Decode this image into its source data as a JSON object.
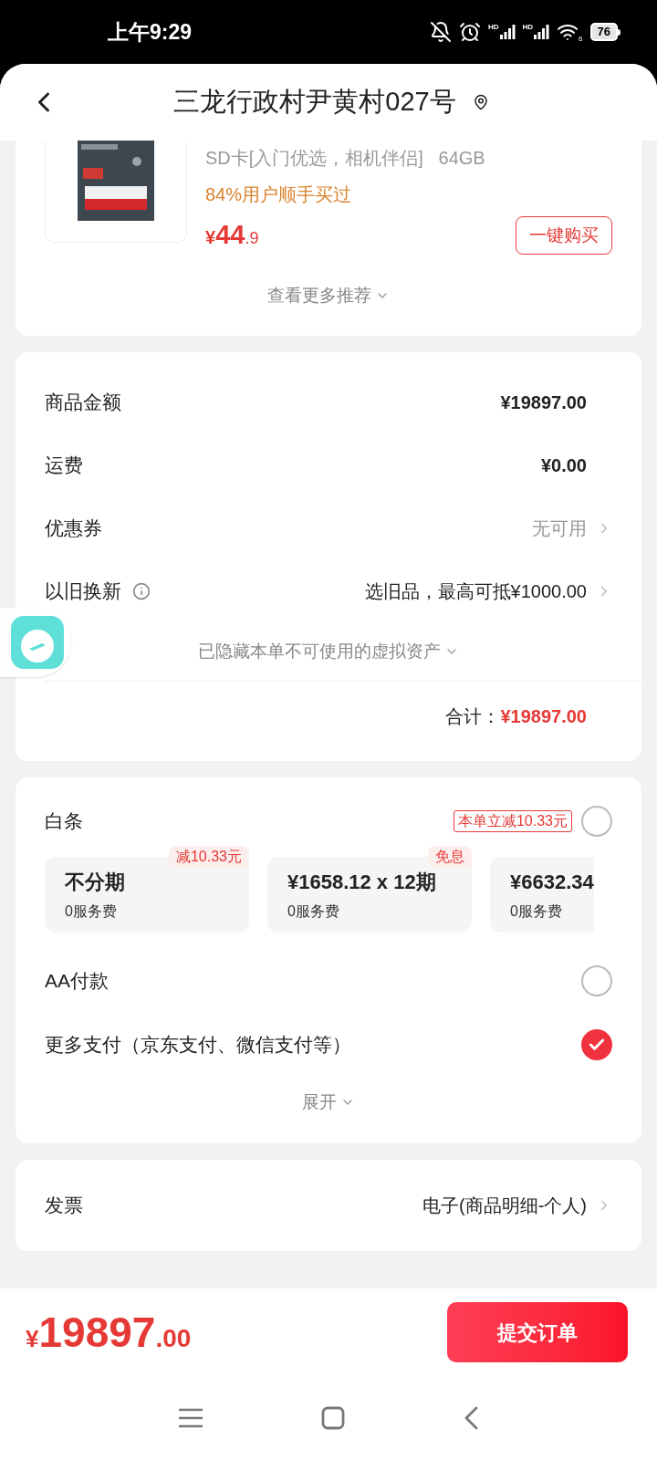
{
  "status_bar": {
    "time": "上午9:29",
    "network_labels": [
      "HD",
      "HD"
    ],
    "wifi_label": "6",
    "battery": "76"
  },
  "header": {
    "title": "三龙行政村尹黄村027号"
  },
  "recommendation": {
    "product_name": "SD卡[入门优选，相机伴侣]   64GB",
    "social_proof": "84%用户顺手买过",
    "price": {
      "symbol": "¥",
      "integer": "44",
      "decimal": ".9"
    },
    "buy_button": "一键购买",
    "more_link": "查看更多推荐"
  },
  "summary": {
    "rows": [
      {
        "label": "商品金额",
        "value": "¥19897.00",
        "kind": "amount",
        "info": false
      },
      {
        "label": "运费",
        "value": "¥0.00",
        "kind": "amount",
        "info": false
      },
      {
        "label": "优惠券",
        "value": "无可用",
        "kind": "muted_link",
        "info": false
      },
      {
        "label": "以旧换新",
        "value": "选旧品，最高可抵¥1000.00",
        "kind": "link",
        "info": true
      }
    ],
    "hidden_note": "已隐藏本单不可使用的虚拟资产",
    "total_label": "合计：",
    "total_value": "¥19897.00"
  },
  "payment": {
    "baitiao": {
      "label": "白条",
      "badge": "本单立减10.33元",
      "selected": false
    },
    "plans": [
      {
        "title": "不分期",
        "fee": "0服务费",
        "tag": "减10.33元"
      },
      {
        "title": "¥1658.12 x 12期",
        "fee": "0服务费",
        "tag": "免息"
      },
      {
        "title": "¥6632.34",
        "fee": "0服务费"
      }
    ],
    "methods": [
      {
        "label": "AA付款",
        "selected": false
      },
      {
        "label": "更多支付（京东支付、微信支付等）",
        "selected": true
      }
    ],
    "expand": "展开"
  },
  "invoice": {
    "label": "发票",
    "value": "电子(商品明细-个人)"
  },
  "footer": {
    "price": {
      "symbol": "¥",
      "integer": "19897",
      "decimal": ".00"
    },
    "submit": "提交订单"
  }
}
